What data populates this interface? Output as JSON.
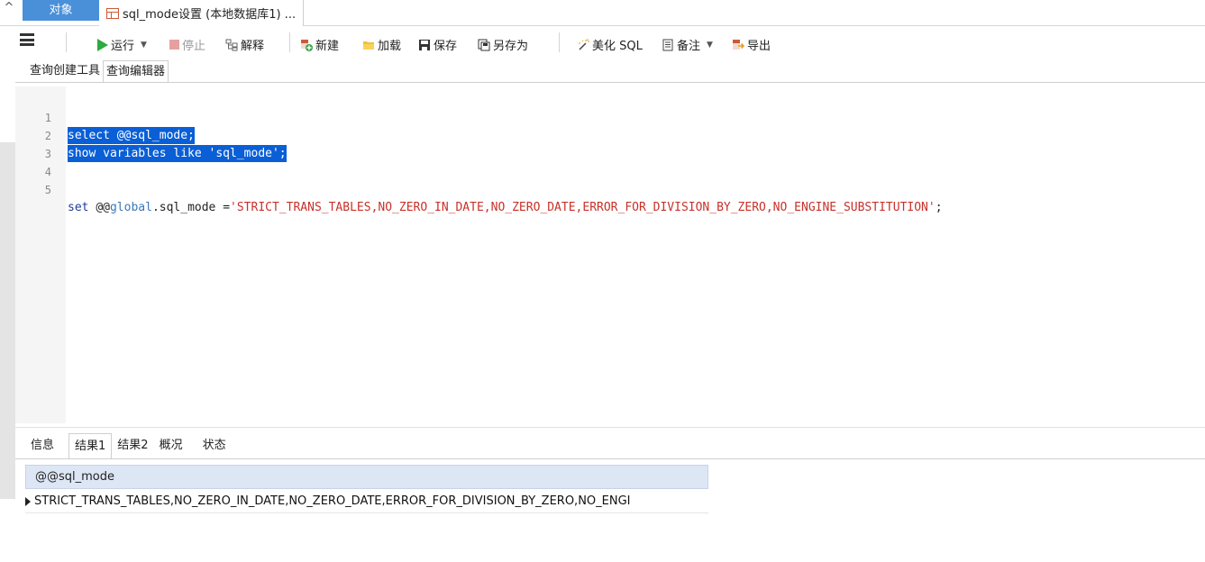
{
  "tabs": {
    "collapse_glyph": "^",
    "objects_label": "对象",
    "document_label": "sql_mode设置 (本地数据库1) ..."
  },
  "toolbar": {
    "run_label": "运行",
    "stop_label": "停止",
    "explain_label": "解释",
    "new_label": "新建",
    "load_label": "加载",
    "save_label": "保存",
    "save_as_label": "另存为",
    "beautify_label": "美化 SQL",
    "note_label": "备注",
    "export_label": "导出"
  },
  "editor_tabs": {
    "builder_label": "查询创建工具",
    "editor_label": "查询编辑器"
  },
  "code": {
    "line_numbers": [
      "1",
      "2",
      "3",
      "4",
      "5"
    ],
    "line1": "select @@sql_mode;",
    "line2": "show variables like 'sql_mode';",
    "line5_set": "set",
    "line5_at": "@@",
    "line5_global": "global",
    "line5_rest": ".sql_mode =",
    "line5_string": "'STRICT_TRANS_TABLES,NO_ZERO_IN_DATE,NO_ZERO_DATE,ERROR_FOR_DIVISION_BY_ZERO,NO_ENGINE_SUBSTITUTION'",
    "line5_end": ";"
  },
  "result_tabs": {
    "info_label": "信息",
    "result1_label": "结果1",
    "result2_label": "结果2",
    "overview_label": "概况",
    "status_label": "状态"
  },
  "result_grid": {
    "columns": [
      "@@sql_mode"
    ],
    "rows": [
      [
        "STRICT_TRANS_TABLES,NO_ZERO_IN_DATE,NO_ZERO_DATE,ERROR_FOR_DIVISION_BY_ZERO,NO_ENGI"
      ]
    ]
  },
  "colors": {
    "accent": "#4a90d9",
    "selection": "#0a5fd6",
    "keyword": "#1e3c9e",
    "string": "#c8312a",
    "grid_header": "#dde6f4"
  }
}
